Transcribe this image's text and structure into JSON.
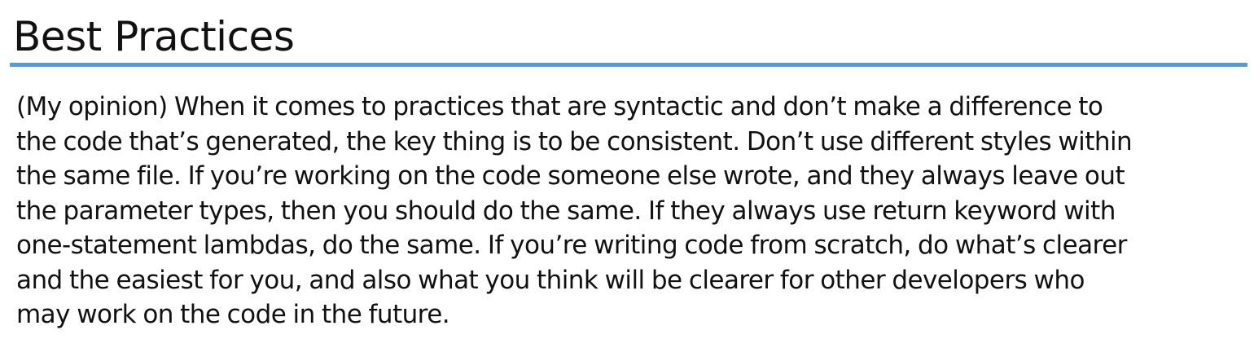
{
  "slide": {
    "title": "Best Practices",
    "accent_color": "#4a9ee6",
    "body_lines": [
      "(My opinion) When it comes to practices that are syntactic and don’t make a difference to",
      "the code that’s generated, the key thing is to be consistent. Don’t use different styles within",
      "the same file. If you’re working on the code someone else wrote, and they always leave out",
      "the parameter types, then you should do the same. If they always use return keyword with",
      "one-statement lambdas, do the same. If you’re writing code from scratch, do what’s clearer",
      "and the easiest for you, and also what you think will be clearer for other developers who",
      "may work on the code in the future."
    ]
  }
}
